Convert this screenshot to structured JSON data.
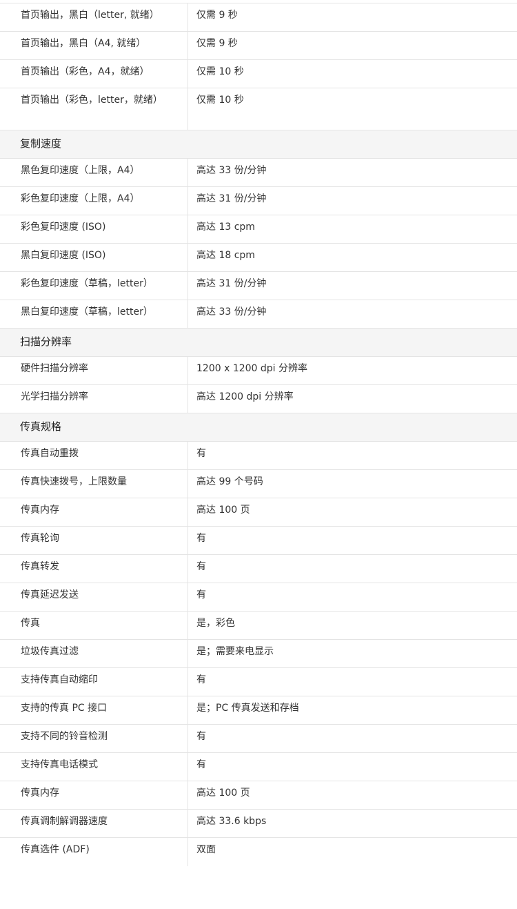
{
  "sections": [
    {
      "rows": [
        {
          "label": "首页输出，黑白（letter, 就绪）",
          "value": "仅需 9 秒"
        },
        {
          "label": "首页输出，黑白（A4, 就绪）",
          "value": "仅需 9 秒"
        },
        {
          "label": "首页输出（彩色，A4，就绪）",
          "value": "仅需 10 秒"
        },
        {
          "label": "首页输出（彩色，letter，就绪）",
          "value": "仅需 10 秒"
        }
      ]
    },
    {
      "title": "复制速度",
      "rows": [
        {
          "label": "黑色复印速度（上限，A4）",
          "value": "高达 33 份/分钟"
        },
        {
          "label": "彩色复印速度（上限，A4）",
          "value": "高达 31 份/分钟"
        },
        {
          "label": "彩色复印速度 (ISO)",
          "value": "高达 13 cpm"
        },
        {
          "label": "黑白复印速度 (ISO)",
          "value": "高达 18 cpm"
        },
        {
          "label": "彩色复印速度（草稿，letter）",
          "value": "高达 31 份/分钟"
        },
        {
          "label": "黑白复印速度（草稿，letter）",
          "value": "高达 33 份/分钟"
        }
      ]
    },
    {
      "title": "扫描分辨率",
      "rows": [
        {
          "label": "硬件扫描分辨率",
          "value": "1200 x 1200 dpi 分辨率"
        },
        {
          "label": "光学扫描分辨率",
          "value": "高达 1200 dpi 分辨率"
        }
      ]
    },
    {
      "title": "传真规格",
      "rows": [
        {
          "label": "传真自动重拨",
          "value": "有"
        },
        {
          "label": "传真快速拨号，上限数量",
          "value": "高达 99 个号码"
        },
        {
          "label": "传真内存",
          "value": "高达 100 页"
        },
        {
          "label": "传真轮询",
          "value": "有"
        },
        {
          "label": "传真转发",
          "value": "有"
        },
        {
          "label": "传真延迟发送",
          "value": "有"
        },
        {
          "label": "传真",
          "value": "是，彩色"
        },
        {
          "label": "垃圾传真过滤",
          "value": "是；需要来电显示"
        },
        {
          "label": "支持传真自动缩印",
          "value": "有"
        },
        {
          "label": "支持的传真 PC 接口",
          "value": "是；PC 传真发送和存档"
        },
        {
          "label": "支持不同的铃音检测",
          "value": "有"
        },
        {
          "label": "支持传真电话模式",
          "value": "有"
        },
        {
          "label": "传真内存",
          "value": "高达 100 页"
        },
        {
          "label": "传真调制解调器速度",
          "value": "高达 33.6 kbps"
        },
        {
          "label": "传真选件 (ADF)",
          "value": "双面"
        }
      ]
    }
  ]
}
